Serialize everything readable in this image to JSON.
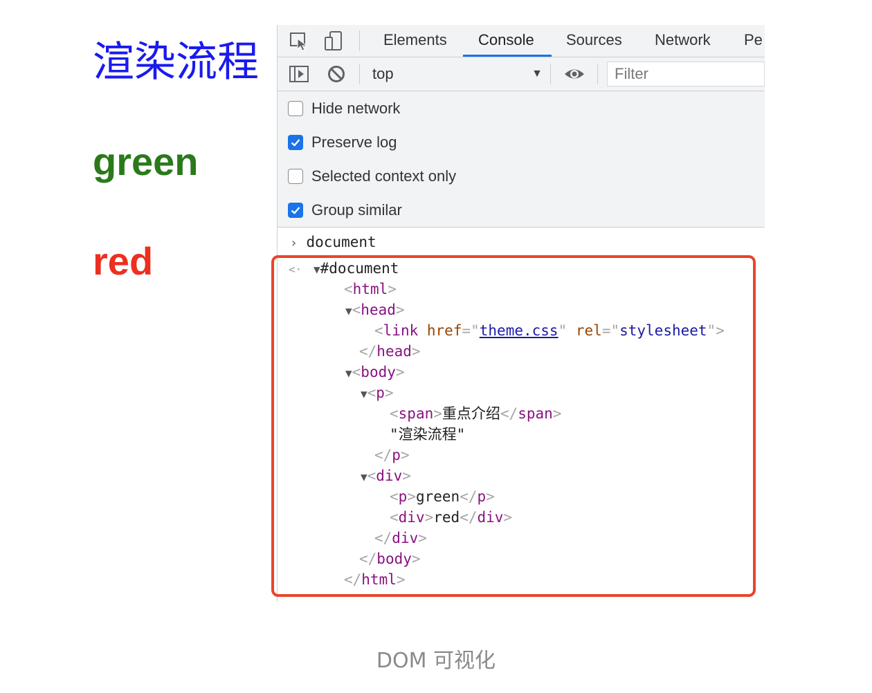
{
  "preview": {
    "title": "渲染流程",
    "green_text": "green",
    "red_text": "red"
  },
  "devtools": {
    "tabs": [
      "Elements",
      "Console",
      "Sources",
      "Network",
      "Pe"
    ],
    "active_tab": "Console",
    "toolbar": {
      "context": "top",
      "filter_placeholder": "Filter"
    },
    "settings": [
      {
        "label": "Hide network",
        "checked": false
      },
      {
        "label": "Preserve log",
        "checked": true
      },
      {
        "label": "Selected context only",
        "checked": false
      },
      {
        "label": "Group similar",
        "checked": true
      }
    ],
    "console": {
      "input": "document",
      "result_root": "#document",
      "tree": {
        "html_open": "html",
        "head": "head",
        "link_tag": "link",
        "href_attr": "href",
        "href_val": "theme.css",
        "rel_attr": "rel",
        "rel_val": "stylesheet",
        "body": "body",
        "p": "p",
        "span": "span",
        "span_text": "重点介绍",
        "p_text": "\"渲染流程\"",
        "div": "div",
        "green_text": "green",
        "red_text": "red"
      }
    }
  },
  "caption": "DOM 可视化",
  "colors": {
    "title_blue": "#1a1aef",
    "green": "#2a7a1a",
    "red": "#ec2f1f",
    "highlight_box": "#e8452a",
    "accent": "#1a73e8"
  }
}
